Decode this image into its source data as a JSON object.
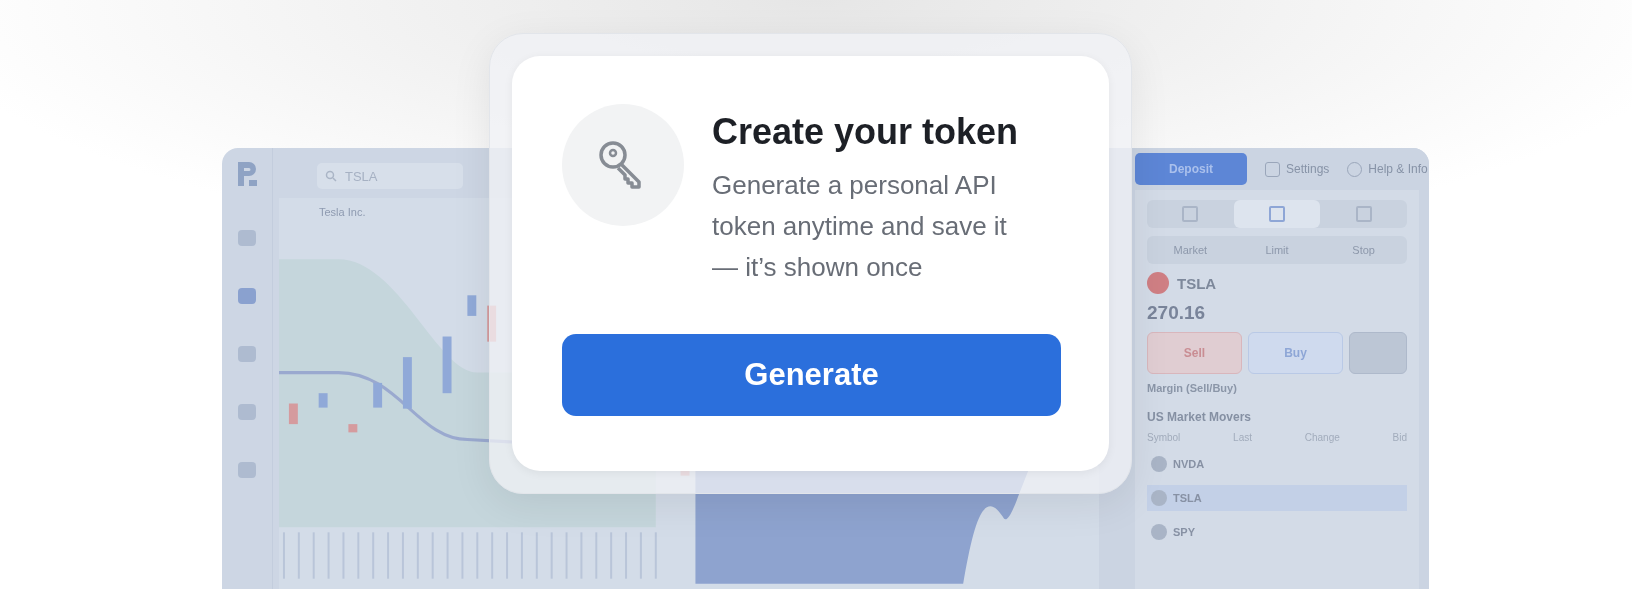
{
  "card": {
    "title": "Create your token",
    "description": "Generate a personal API token anytime and save it — it’s shown once",
    "button": "Generate"
  },
  "background_app": {
    "search": {
      "value": "TSLA"
    },
    "instrument": "Tesla Inc.",
    "header_buttons": [
      {
        "label": "Deposit",
        "kind": "primary"
      },
      {
        "label": "Settings",
        "kind": "settings"
      },
      {
        "label": "Help & Info",
        "kind": "help"
      }
    ],
    "order_types": [
      "Market",
      "Limit",
      "Stop"
    ],
    "symbol": "TSLA",
    "price": "270.16",
    "sell": "Sell",
    "buy": "Buy",
    "margin_label": "Margin (Sell/Buy)",
    "movers": {
      "title": "US Market Movers",
      "columns": [
        "Symbol",
        "Last",
        "Change",
        "Bid"
      ],
      "rows": [
        {
          "symbol": "NVDA",
          "selected": false
        },
        {
          "symbol": "TSLA",
          "selected": true
        },
        {
          "symbol": "SPY",
          "selected": false
        }
      ]
    }
  }
}
